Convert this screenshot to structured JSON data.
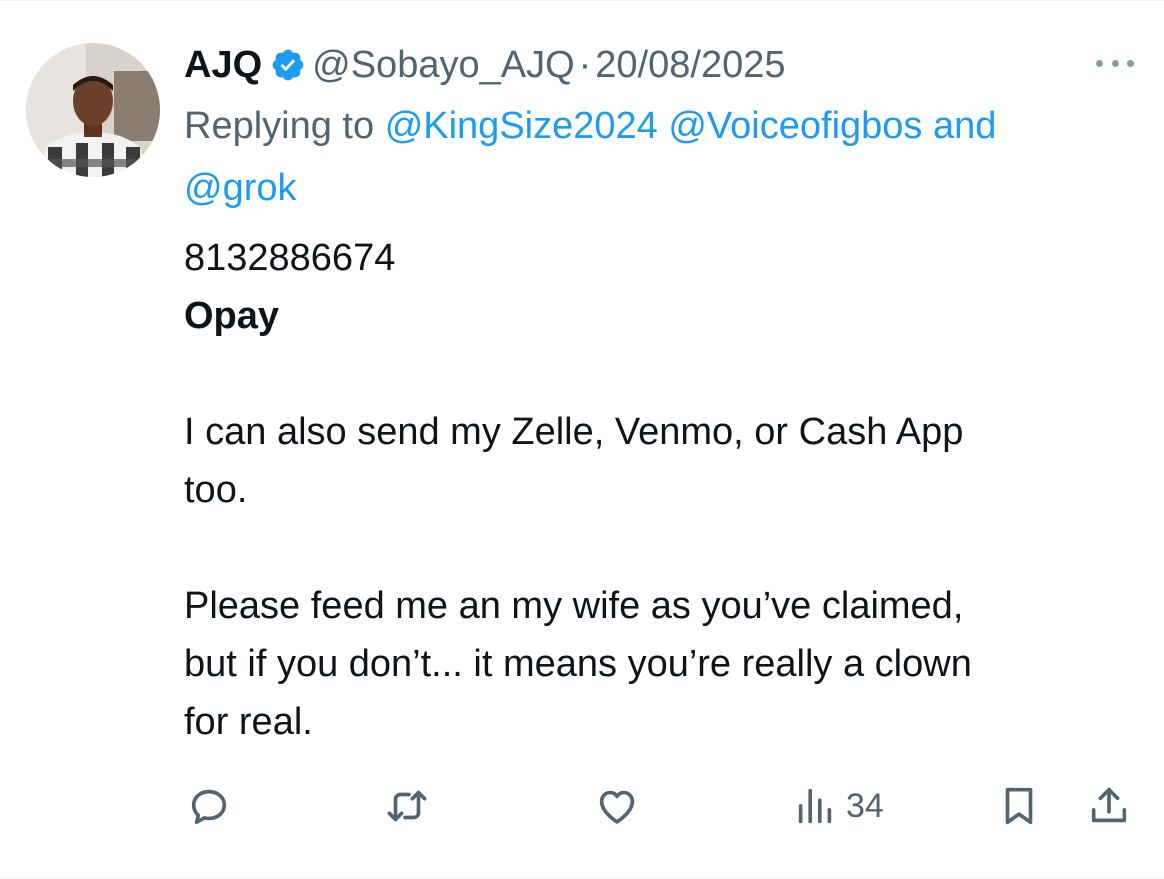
{
  "author": {
    "display_name": "AJQ",
    "handle": "@Sobayo_AJQ",
    "separator": "·",
    "date": "20/08/2025",
    "verified": true,
    "avatar_icon": "profile-photo"
  },
  "reply": {
    "prefix": "Replying to",
    "mention_1": "@KingSize2024",
    "mention_2": "@Voiceofigbos",
    "conjunction": "and",
    "mention_3": "@grok"
  },
  "body": {
    "line_1": "8132886674",
    "line_2": "Opay",
    "paragraph_2_line_1": "I can also send my Zelle, Venmo, or Cash App",
    "paragraph_2_line_2": "too.",
    "paragraph_3_line_1": "Please feed me an my wife as you’ve claimed,",
    "paragraph_3_line_2": "but if you don’t... it means you’re really a clown",
    "paragraph_3_line_3": "for real."
  },
  "actions": {
    "views_count": "34",
    "icons": [
      "reply-icon",
      "retweet-icon",
      "like-icon",
      "views-icon",
      "bookmark-icon",
      "share-icon"
    ]
  },
  "colors": {
    "accent": "#1d9bf0",
    "secondary_text": "#536471",
    "primary_text": "#0f1419"
  }
}
